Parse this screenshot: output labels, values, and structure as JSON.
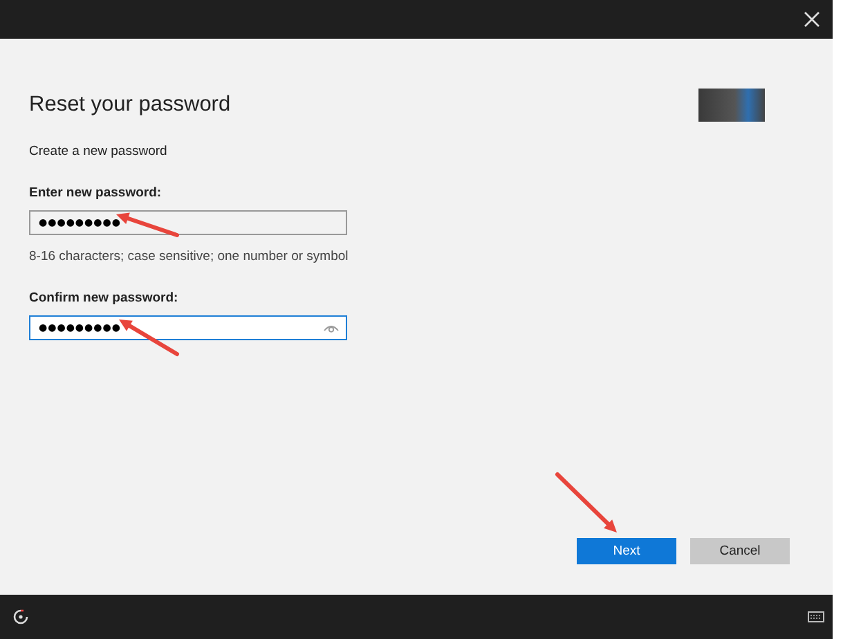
{
  "title": "Reset your password",
  "subtitle": "Create a new password",
  "fields": [
    {
      "label": "Enter new password:",
      "value": "●●●●●●●●●",
      "focused": false,
      "hint": "8-16 characters; case sensitive; one number or symbol"
    },
    {
      "label": "Confirm new password:",
      "value": "●●●●●●●●●",
      "focused": true
    }
  ],
  "buttons": [
    {
      "label": "Next",
      "kind": "primary"
    },
    {
      "label": "Cancel",
      "kind": "secondary"
    }
  ]
}
